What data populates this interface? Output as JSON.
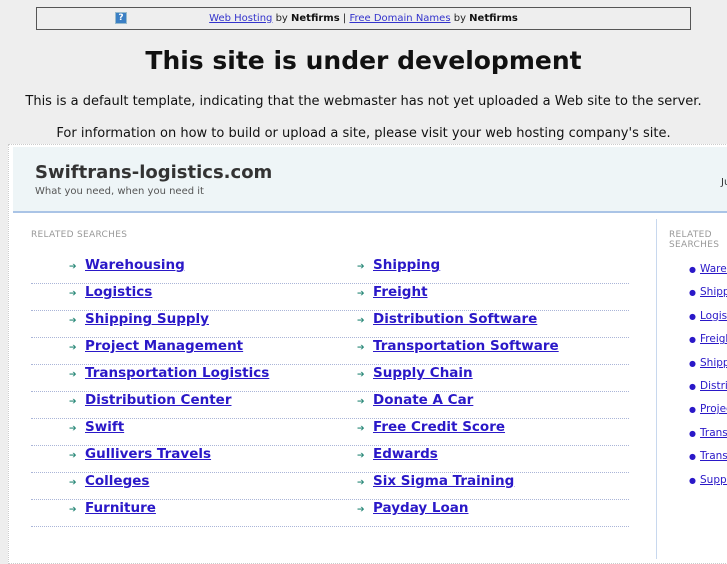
{
  "topbar": {
    "link1": "Web Hosting",
    "by1": "by",
    "brand1": "Netfirms",
    "sep": "|",
    "link2": "Free Domain Names",
    "by2": "by",
    "brand2": "Netfirms",
    "help_icon": "?"
  },
  "title": "This site is under development",
  "message1": "This is a default template, indicating that the webmaster has not yet uploaded a Web site to the server.",
  "message2": "For information on how to build or upload a site, please visit your web hosting company's site.",
  "site": {
    "name": "Swiftrans-logistics.com",
    "tagline": "What you need, when you need it",
    "header_right": "Ju"
  },
  "related_label": "RELATED SEARCHES",
  "left_col": [
    "Warehousing",
    "Logistics",
    "Shipping Supply",
    "Project Management",
    "Transportation Logistics",
    "Distribution Center",
    "Swift",
    "Gullivers Travels",
    "Colleges",
    "Furniture"
  ],
  "right_col": [
    "Shipping",
    "Freight",
    "Distribution Software",
    "Transportation Software",
    "Supply Chain",
    "Donate A Car",
    "Free Credit Score",
    "Edwards",
    "Six Sigma Training",
    "Payday Loan"
  ],
  "sidebar_label": "RELATED SEARCHES",
  "sidebar": [
    "Warehousing",
    "Shipping",
    "Logistics",
    "Freight",
    "Shipping Supply",
    "Distribution Software",
    "Project Management",
    "Transportation Software",
    "Transportation Logistics",
    "Supply Chain"
  ]
}
